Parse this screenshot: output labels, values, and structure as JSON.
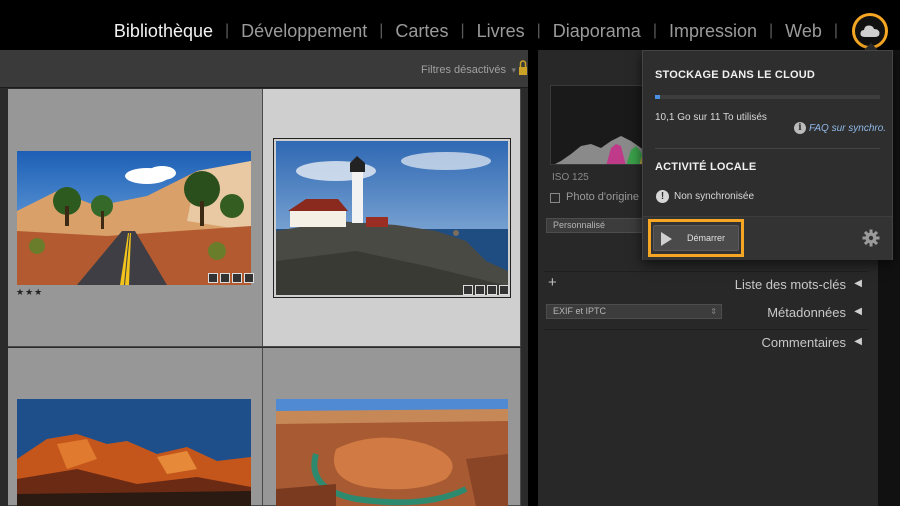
{
  "modules": [
    {
      "label": "Bibliothèque",
      "active": true
    },
    {
      "label": "Développement",
      "active": false
    },
    {
      "label": "Cartes",
      "active": false
    },
    {
      "label": "Livres",
      "active": false
    },
    {
      "label": "Diaporama",
      "active": false
    },
    {
      "label": "Impression",
      "active": false
    },
    {
      "label": "Web",
      "active": false
    }
  ],
  "separator": "|",
  "accent_color": "#f5a623",
  "filter": {
    "label": "Filtres désactivés",
    "chevron": "▾"
  },
  "grid": {
    "photos": [
      {
        "subject": "desert road",
        "stars": "★★★",
        "selected": false
      },
      {
        "subject": "lighthouse",
        "stars": "",
        "selected": true
      },
      {
        "subject": "red rock mountain",
        "stars": "",
        "selected": false
      },
      {
        "subject": "horseshoe bend canyon",
        "stars": "",
        "selected": false
      }
    ]
  },
  "right_panel": {
    "iso": "ISO 125",
    "original_photo": "Photo d'origine",
    "preset_select": "Personnalisé",
    "keywords_title": "Liste des mots-clés",
    "metadata_select": "EXIF et IPTC",
    "metadata_title": "Métadonnées",
    "comments_title": "Commentaires",
    "plus": "+",
    "collapse_glyph": "◀"
  },
  "cloud_popup": {
    "storage_title": "STOCKAGE DANS LE CLOUD",
    "storage_used_fraction": 0.0092,
    "usage_text": "10,1 Go sur 11 To utilisés",
    "faq_link": "FAQ sur synchro.",
    "info_glyph": "i",
    "local_title": "ACTIVITÉ LOCALE",
    "local_status": "Non synchronisée",
    "warn_glyph": "!",
    "start_label": "Démarrer"
  },
  "icons": [
    "cloud-icon",
    "lock-icon",
    "play-icon",
    "gear-icon",
    "info-icon",
    "warning-icon"
  ]
}
